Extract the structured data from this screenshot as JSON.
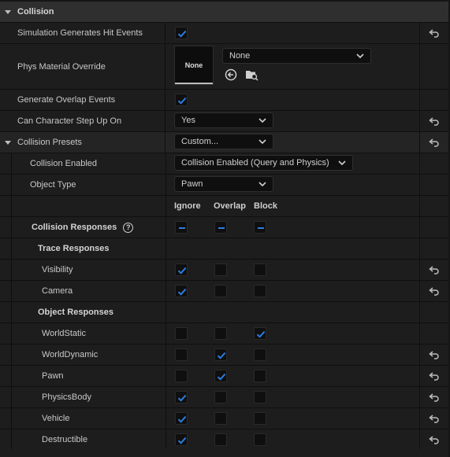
{
  "section": {
    "title": "Collision"
  },
  "sim_hit": {
    "label": "Simulation Generates Hit Events",
    "checked": true
  },
  "phys_material": {
    "label": "Phys Material Override",
    "thumb_text": "None",
    "combo_value": "None"
  },
  "overlap_events": {
    "label": "Generate Overlap Events",
    "checked": true
  },
  "step_up": {
    "label": "Can Character Step Up On",
    "value": "Yes"
  },
  "presets": {
    "label": "Collision Presets",
    "value": "Custom..."
  },
  "collision_enabled": {
    "label": "Collision Enabled",
    "value": "Collision Enabled (Query and Physics)"
  },
  "object_type": {
    "label": "Object Type",
    "value": "Pawn"
  },
  "columns": {
    "ignore": "Ignore",
    "overlap": "Overlap",
    "block": "Block"
  },
  "responses": {
    "label": "Collision Responses",
    "help": "?"
  },
  "trace_responses": {
    "label": "Trace Responses",
    "rows": [
      {
        "name": "Visibility",
        "state": "ignore",
        "reset": true
      },
      {
        "name": "Camera",
        "state": "ignore",
        "reset": true
      }
    ]
  },
  "object_responses": {
    "label": "Object Responses",
    "rows": [
      {
        "name": "WorldStatic",
        "state": "block",
        "reset": false
      },
      {
        "name": "WorldDynamic",
        "state": "overlap",
        "reset": true
      },
      {
        "name": "Pawn",
        "state": "overlap",
        "reset": true
      },
      {
        "name": "PhysicsBody",
        "state": "ignore",
        "reset": true
      },
      {
        "name": "Vehicle",
        "state": "ignore",
        "reset": true
      },
      {
        "name": "Destructible",
        "state": "ignore",
        "reset": true
      }
    ]
  },
  "colors": {
    "accent": "#2b7de0",
    "background": "#151515",
    "row": "#1d1d1d"
  }
}
